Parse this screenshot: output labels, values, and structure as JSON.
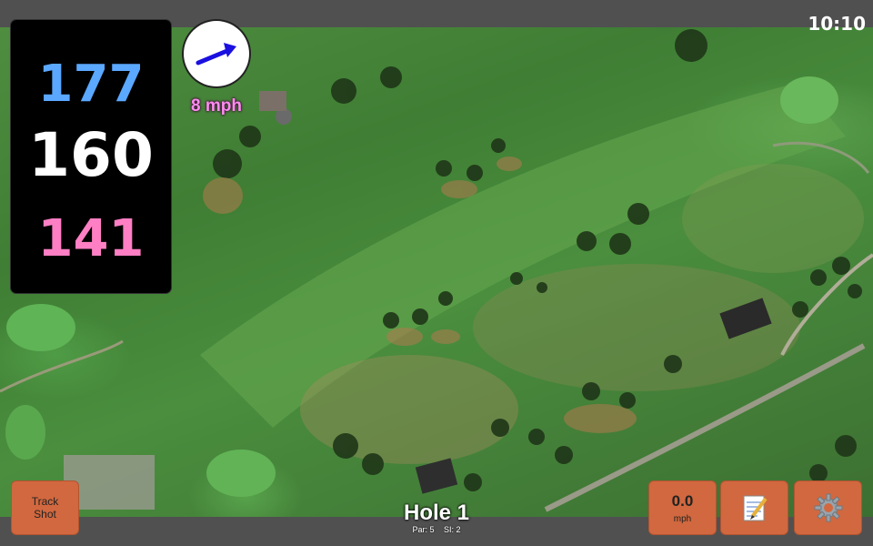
{
  "status_bar": {
    "time": "10:10"
  },
  "distances": {
    "back": "177",
    "middle": "160",
    "front": "141"
  },
  "wind": {
    "speed_label": "8 mph",
    "arrow_icon": "arrow-icon"
  },
  "buttons": {
    "track_shot_line1": "Track",
    "track_shot_line2": "Shot",
    "speed_value": "0.0",
    "speed_unit": "mph",
    "notes_icon": "notepad-icon",
    "settings_icon": "gear-icon"
  },
  "hole": {
    "title": "Hole 1",
    "par": "Par: 5",
    "si": "SI: 2"
  },
  "colors": {
    "back_distance": "#5aa8ff",
    "middle_distance": "#ffffff",
    "front_distance": "#ff7fc4",
    "button": "#d1683f",
    "wind_label": "#ff8cf0"
  }
}
